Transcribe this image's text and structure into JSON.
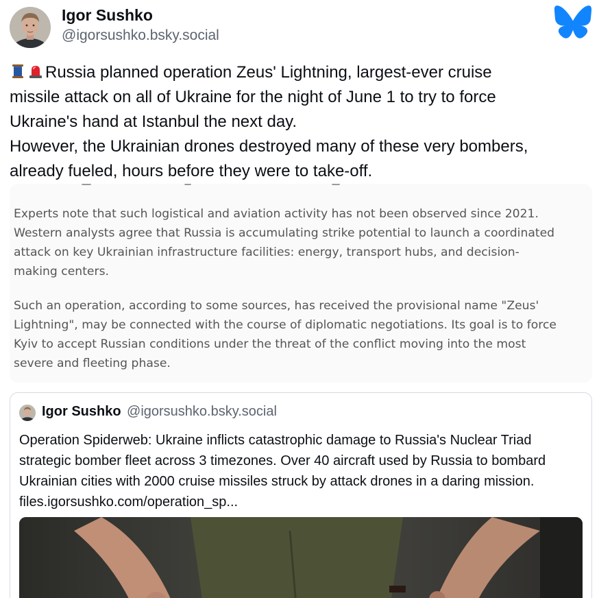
{
  "post": {
    "author_name": "Igor Sushko",
    "author_handle": "@igorsushko.bsky.social",
    "text_lines": [
      "Russia planned operation Zeus' Lightning, largest-ever cruise",
      "missile attack on all of Ukraine for the night of June 1 to try to force",
      "Ukraine's hand at Istanbul the next day.",
      "However, the Ukrainian drones destroyed many of these very bombers,",
      "already fueled, hours before they were to take-off."
    ],
    "leading_emojis": [
      "thread-spool-icon",
      "police-light-icon"
    ]
  },
  "embed_image": {
    "paragraph_1": [
      "Experts note that such logistical and aviation activity has not been observed since 2021.",
      "Western analysts agree that Russia is accumulating strike potential to launch a coordinated",
      "attack on key Ukrainian infrastructure facilities: energy, transport hubs, and decision-",
      "making centers."
    ],
    "paragraph_2": [
      "Such an operation, according to some sources, has received the provisional name \"Zeus'",
      "Lightning\", may be connected with the course of diplomatic negotiations. Its goal is to force",
      "Kyiv to accept Russian conditions under the threat of the conflict moving into the most",
      "severe and fleeting phase."
    ]
  },
  "quote": {
    "author_name": "Igor Sushko",
    "author_handle": "@igorsushko.bsky.social",
    "text_lines": [
      "Operation Spiderweb: Ukraine inflicts catastrophic damage to Russia's Nuclear Triad",
      "strategic bomber fleet across 3 timezones. Over 40 aircraft used by Russia to bombard",
      "Ukrainian cities with 2000 cruise missiles struck by attack drones in a daring mission.",
      "files.igorsushko.com/operation_sp..."
    ]
  },
  "colors": {
    "bluesky_brand": "#1185fe",
    "handle_gray": "#5c6470",
    "quote_border": "#d4dbe2",
    "emergency_red": "#e0202a"
  }
}
